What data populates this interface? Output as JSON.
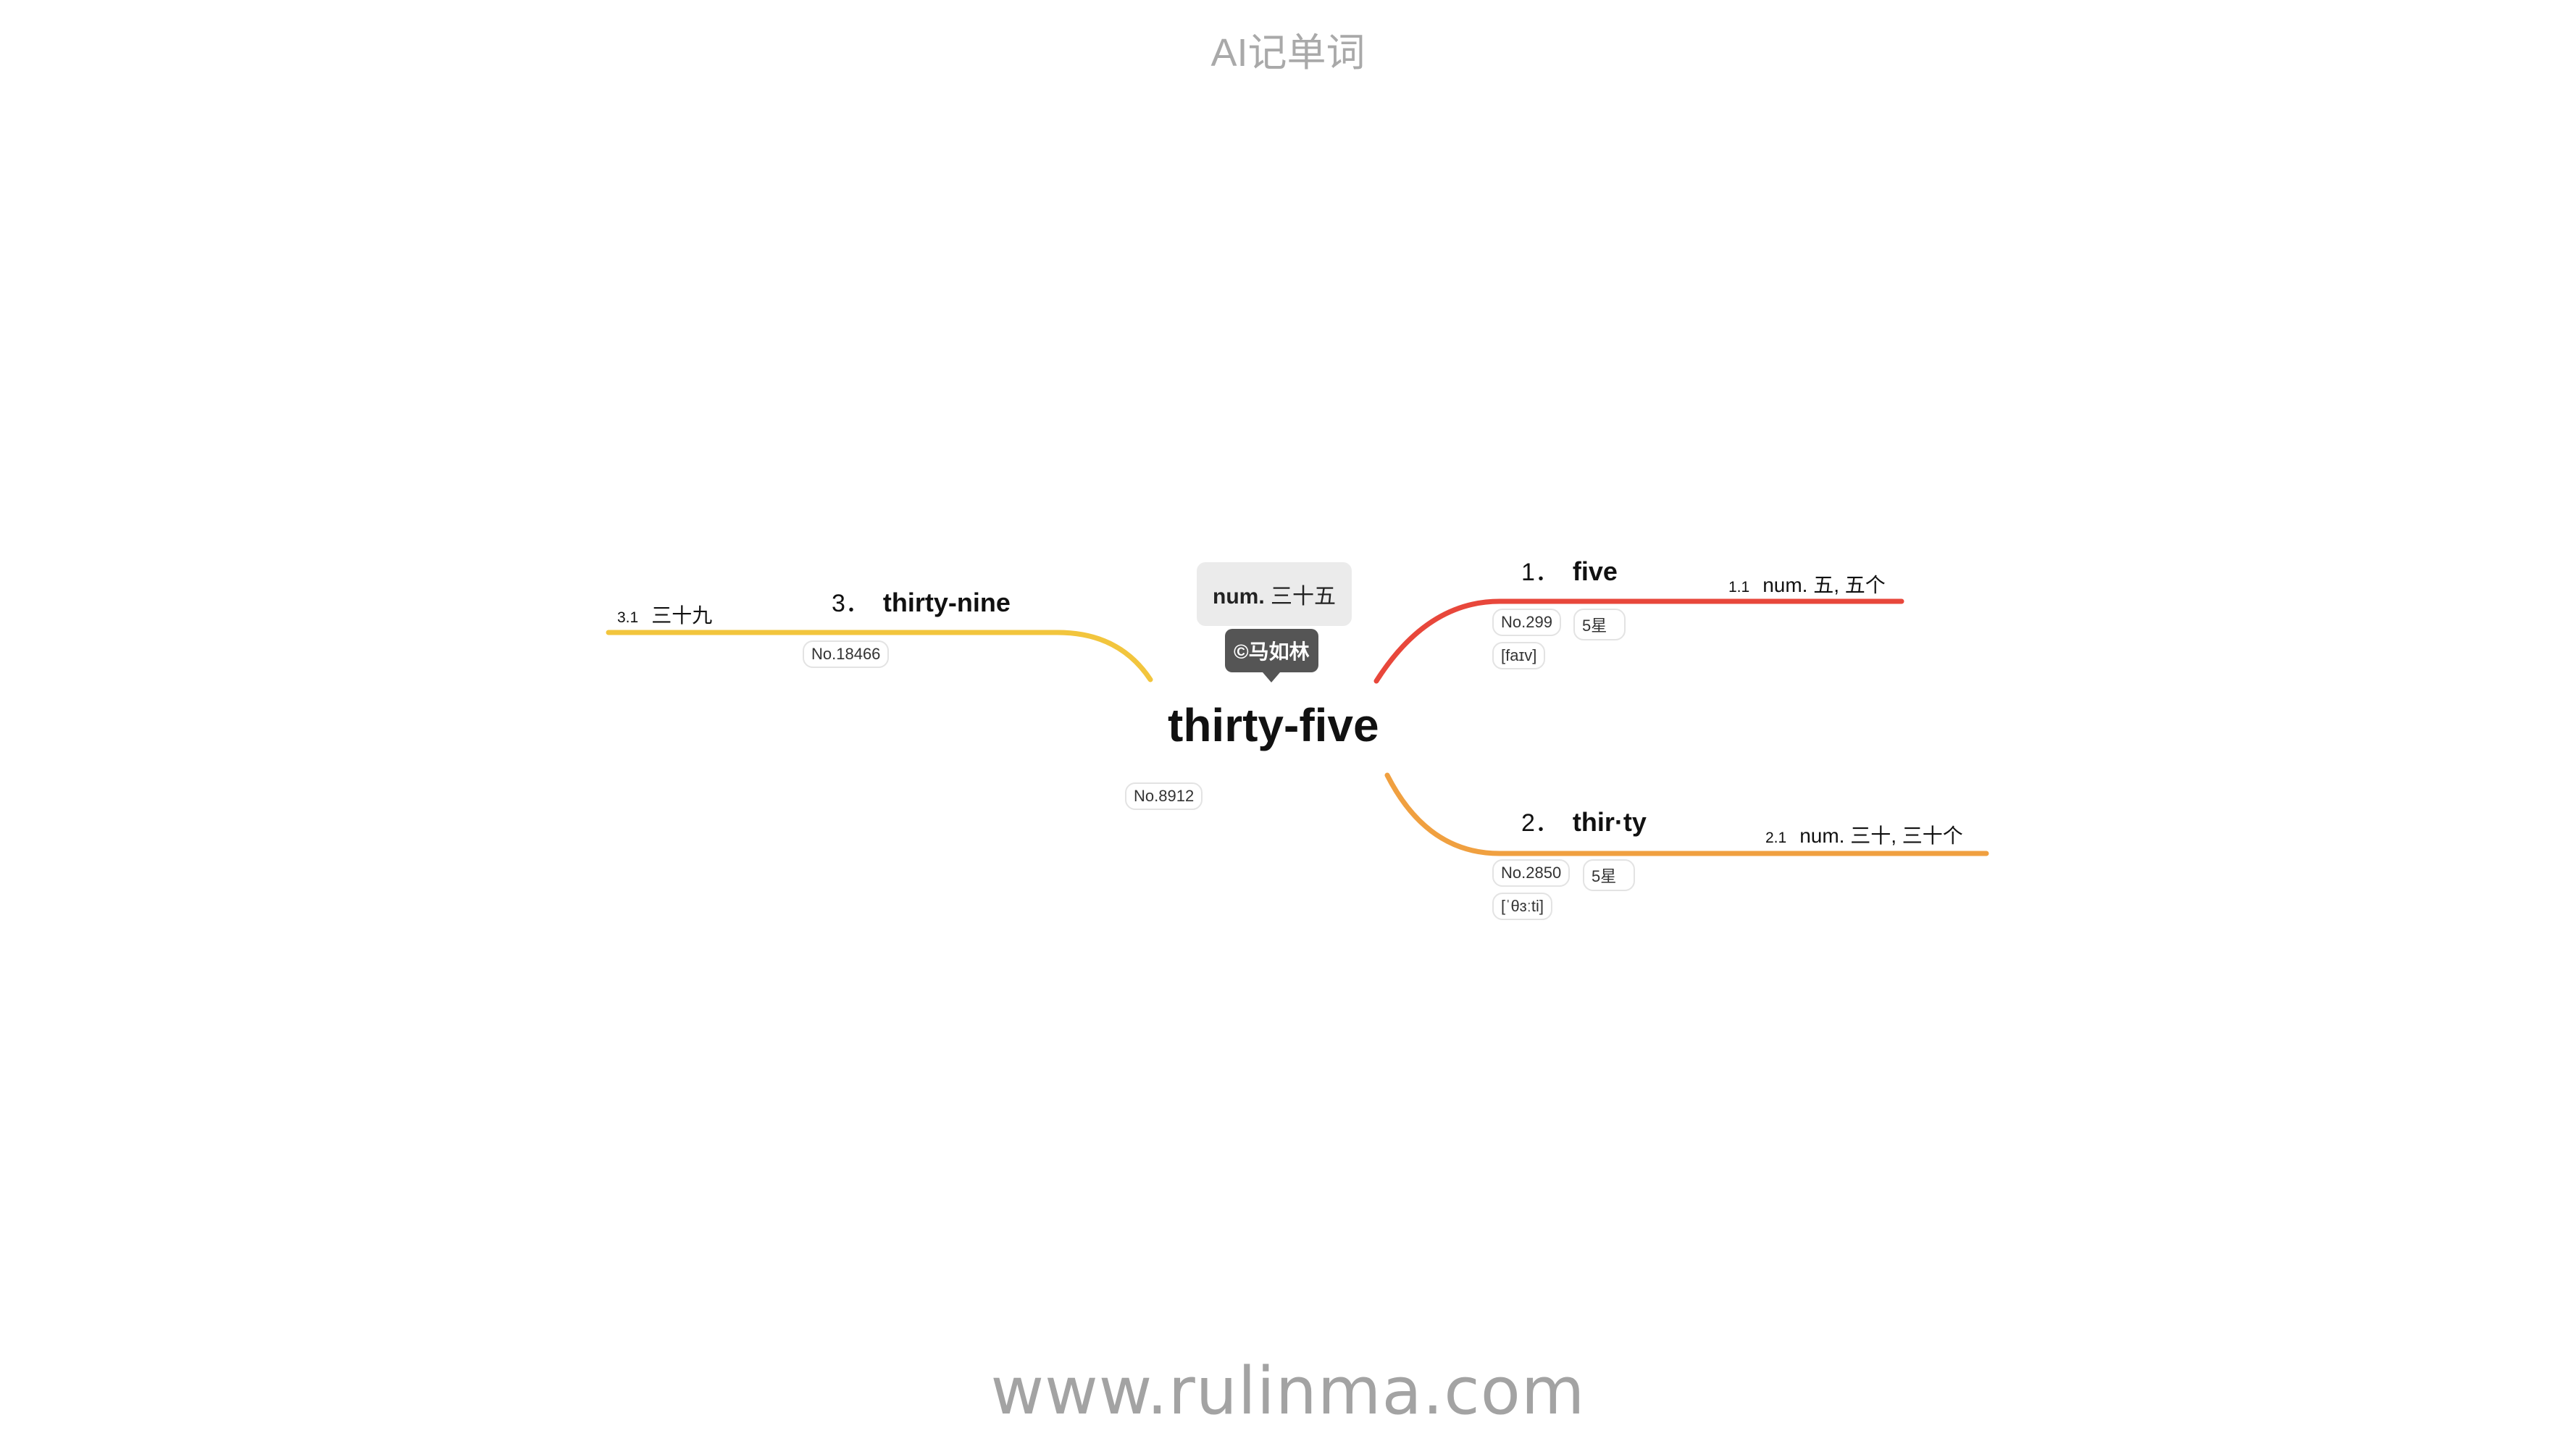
{
  "header": {
    "title": "AI记单词"
  },
  "footer": {
    "url": "www.rulinma.com"
  },
  "center": {
    "word": "thirty-five",
    "definition_pos": "num.",
    "definition_text": "三十五",
    "author": "©马如林",
    "rank": "No.8912"
  },
  "branches": [
    {
      "index": "1．",
      "word": "five",
      "rank": "No.299",
      "stars": "5星",
      "phonetic": "[faɪv]",
      "color": "#e8473b",
      "sub_index": "1.1",
      "sub_text": "num. 五, 五个"
    },
    {
      "index": "2．",
      "word": "thir·ty",
      "rank": "No.2850",
      "stars": "5星",
      "phonetic": "[ˈθɜːti]",
      "color": "#f0a040",
      "sub_index": "2.1",
      "sub_text": "num. 三十, 三十个"
    },
    {
      "index": "3．",
      "word": "thirty-nine",
      "rank": "No.18466",
      "color": "#f2c53d",
      "sub_index": "3.1",
      "sub_text": "三十九"
    }
  ]
}
